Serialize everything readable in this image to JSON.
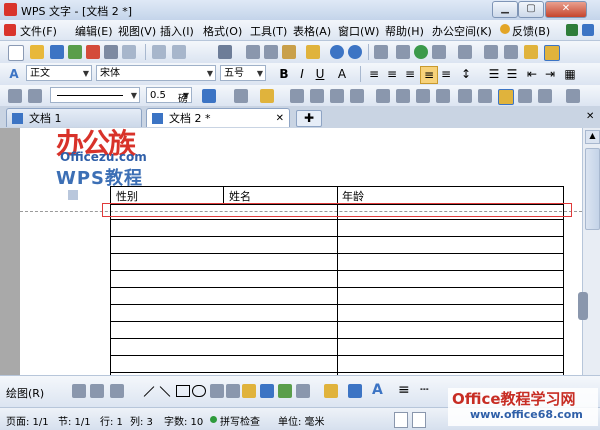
{
  "window": {
    "title": "WPS 文字 - [文档 2 *]"
  },
  "menu": [
    "文件(F)",
    "编辑(E)",
    "视图(V)",
    "插入(I)",
    "格式(O)",
    "工具(T)",
    "表格(A)",
    "窗口(W)",
    "帮助(H)",
    "办公空间(K)",
    "反馈(B)"
  ],
  "format": {
    "style": "正文",
    "font": "宋体",
    "size": "五号",
    "line_width": "0.5",
    "line_unit": "磅"
  },
  "tabs": [
    {
      "label": "文档 1"
    },
    {
      "label": "文档 2 *"
    }
  ],
  "logo": {
    "brand": "办公族",
    "site": "Officezu.com",
    "sub": "WPS教程"
  },
  "table": {
    "headers": [
      "性别",
      "姓名",
      "年龄"
    ],
    "empty_rows": 12
  },
  "drawbar": {
    "label": "绘图(R)"
  },
  "status": {
    "page": "页面: 1/1",
    "section": "节: 1/1",
    "row": "行: 1",
    "col": "列: 3",
    "words": "字数: 10",
    "spell": "拼写检查",
    "unit": "单位: 毫米"
  },
  "watermark": {
    "text": "Office教程学习网",
    "url": "www.office68.com"
  },
  "colors": {
    "accent": "#3c74c4",
    "selection": "#e03a3a",
    "brand_red": "#d8322a"
  }
}
